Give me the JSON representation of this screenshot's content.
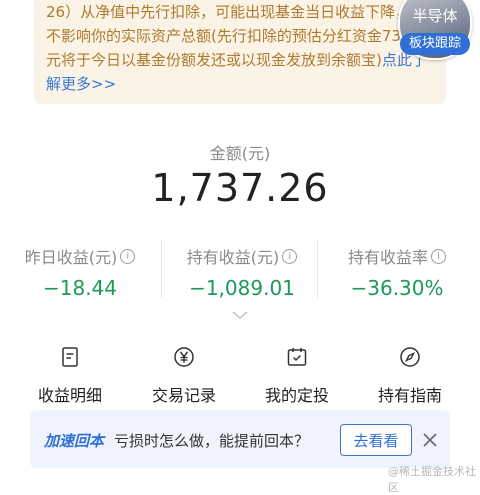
{
  "notice": {
    "text": "26）从净值中先行扣除，可能出现基金当日收益下降，但不影响你的实际资产总额(先行扣除的预估分红资金73.80元将于今日以基金份额发还或以现金发放到余额宝)",
    "link": "点此了解更多>>"
  },
  "float_badge": {
    "title": "半导体",
    "label": "板块跟踪"
  },
  "amount": {
    "label": "金额(元)",
    "value": "1,737.26"
  },
  "stats": [
    {
      "label": "昨日收益(元)",
      "value": "−18.44"
    },
    {
      "label": "持有收益(元)",
      "value": "−1,089.01"
    },
    {
      "label": "持有收益率",
      "value": "−36.30%"
    }
  ],
  "colors": {
    "accent": "#2f6fd6",
    "profit_green": "#1d9a5a",
    "notice_bg": "#fbf3e5",
    "notice_text": "#ad7a30"
  },
  "menu": [
    {
      "label": "收益明细",
      "icon": "document-icon"
    },
    {
      "label": "交易记录",
      "icon": "yen-circle-icon"
    },
    {
      "label": "我的定投",
      "icon": "calendar-check-icon"
    },
    {
      "label": "持有指南",
      "icon": "compass-icon"
    }
  ],
  "tip": {
    "title": "加速回本",
    "text": "亏损时怎么做，能提前回本？",
    "button": "去看看"
  },
  "watermark": "@稀土掘金技术社区"
}
